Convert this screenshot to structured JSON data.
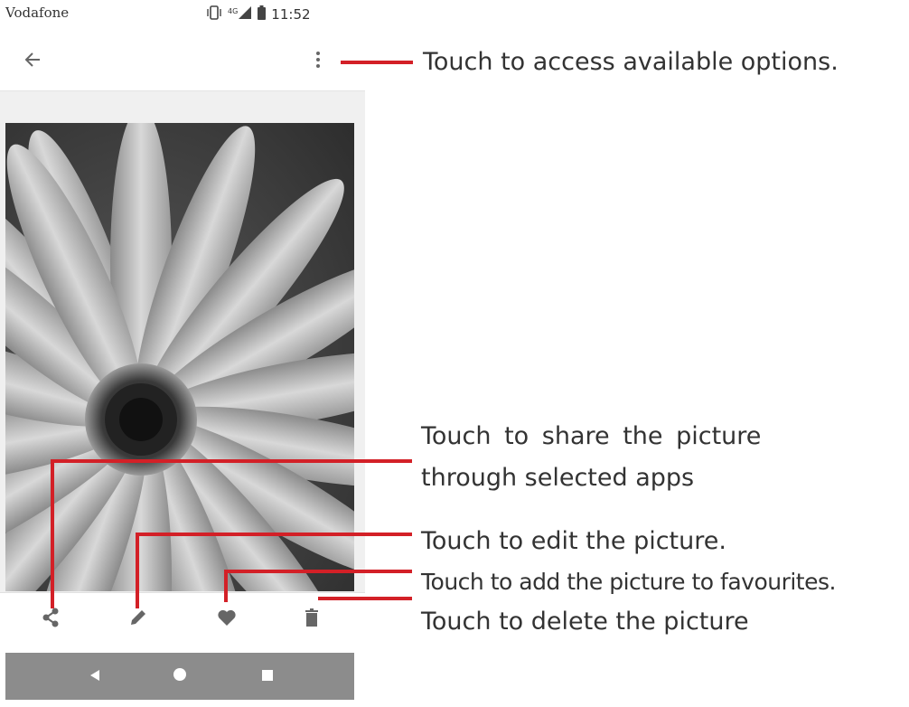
{
  "status_bar": {
    "carrier": "Vodafone",
    "network": "4G",
    "time": "11:52"
  },
  "app_bar": {
    "back_icon": "arrow-back-icon",
    "menu_icon": "more-vertical-icon"
  },
  "bottom_actions": [
    {
      "name": "share",
      "icon": "share-icon"
    },
    {
      "name": "edit",
      "icon": "pencil-icon"
    },
    {
      "name": "favourite",
      "icon": "heart-icon"
    },
    {
      "name": "delete",
      "icon": "trash-icon"
    }
  ],
  "nav_bar": {
    "back_icon": "nav-back-triangle-icon",
    "home_icon": "nav-home-circle-icon",
    "recents_icon": "nav-recents-square-icon"
  },
  "annotations": {
    "options": "Touch to access available options.",
    "share_line1": "Touch to share the picture",
    "share_line2": "through selected apps",
    "edit": "Touch to edit the picture.",
    "favourite": "Touch to add the picture to favourites.",
    "delete": "Touch to delete the picture"
  },
  "colors": {
    "callout": "#d32027",
    "nav_bar": "#8c8c8c",
    "text": "#333333"
  }
}
